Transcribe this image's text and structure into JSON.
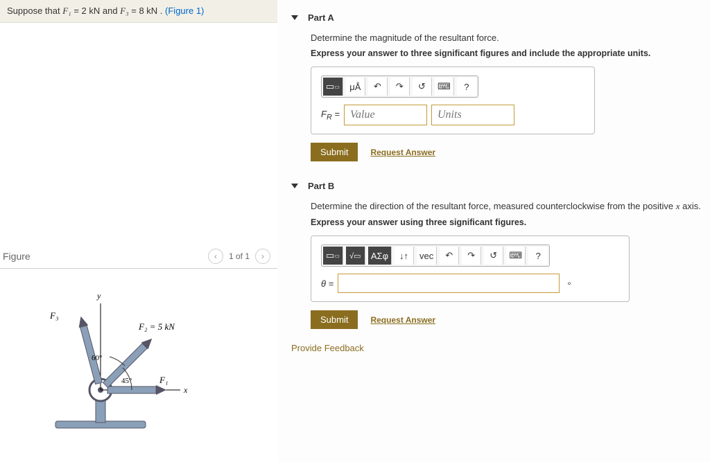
{
  "problem": {
    "text_prefix": "Suppose that ",
    "f1_label": "F₁",
    "f1_eq": " = 2 kN",
    "and": " and ",
    "f3_label": "F₃",
    "f3_eq": " = 8 kN",
    "suffix": " . ",
    "figure_link": "(Figure 1)"
  },
  "figure": {
    "title": "Figure",
    "pager": "1 of 1",
    "y_label": "y",
    "x_label": "x",
    "f1_label": "F₁",
    "f2_label": "F₂ = 5 kN",
    "f3_label": "F₃",
    "angle1": "60°",
    "angle2": "45°"
  },
  "partA": {
    "title": "Part A",
    "prompt": "Determine the magnitude of the resultant force.",
    "instruct": "Express your answer to three significant figures and include the appropriate units.",
    "var_label": "F_R =",
    "value_ph": "Value",
    "units_ph": "Units",
    "submit": "Submit",
    "request": "Request Answer",
    "tb_units": "μÅ"
  },
  "partB": {
    "title": "Part B",
    "prompt": "Determine the direction of the resultant force, measured counterclockwise from the positive x axis.",
    "instruct": "Express your answer using three significant figures.",
    "var_label": "θ =",
    "deg": "∘",
    "submit": "Submit",
    "request": "Request Answer",
    "tb_greek": "ΑΣφ",
    "tb_vec": "vec"
  },
  "feedback": "Provide Feedback"
}
